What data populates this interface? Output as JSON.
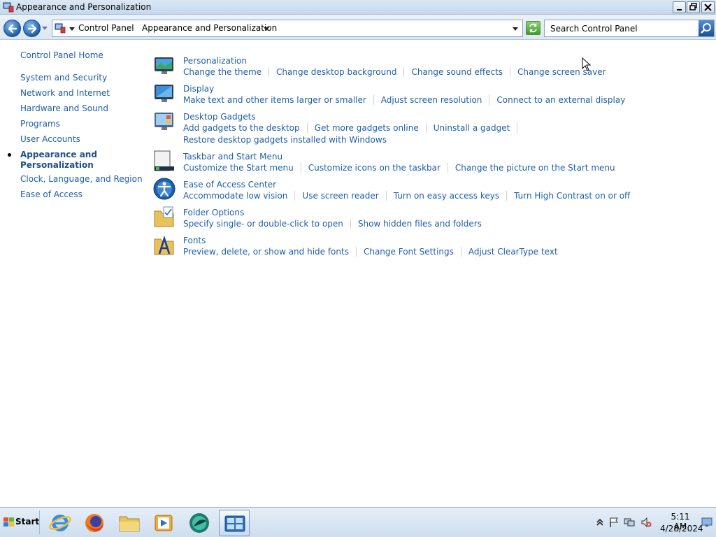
{
  "window": {
    "title": "Appearance and Personalization"
  },
  "address": {
    "crumbs": [
      "Control Panel",
      "Appearance and Personalization"
    ]
  },
  "search": {
    "placeholder": "Search Control Panel"
  },
  "leftnav": {
    "home": "Control Panel Home",
    "items": [
      "System and Security",
      "Network and Internet",
      "Hardware and Sound",
      "Programs",
      "User Accounts",
      "Appearance and Personalization",
      "Clock, Language, and Region",
      "Ease of Access"
    ],
    "current_lines": [
      "Appearance and",
      "Personalization"
    ]
  },
  "sections": [
    {
      "title": "Personalization",
      "icon": "personalization-icon",
      "links": [
        "Change the theme",
        "Change desktop background",
        "Change sound effects",
        "Change screen saver"
      ]
    },
    {
      "title": "Display",
      "icon": "display-icon",
      "links": [
        "Make text and other items larger or smaller",
        "Adjust screen resolution",
        "Connect to an external display"
      ]
    },
    {
      "title": "Desktop Gadgets",
      "icon": "gadgets-icon",
      "links": [
        "Add gadgets to the desktop",
        "Get more gadgets online",
        "Uninstall a gadget"
      ],
      "links_row2": [
        "Restore desktop gadgets installed with Windows"
      ]
    },
    {
      "title": "Taskbar and Start Menu",
      "icon": "taskbar-icon",
      "links": [
        "Customize the Start menu",
        "Customize icons on the taskbar",
        "Change the picture on the Start menu"
      ]
    },
    {
      "title": "Ease of Access Center",
      "icon": "ease-of-access-icon",
      "links": [
        "Accommodate low vision",
        "Use screen reader",
        "Turn on easy access keys",
        "Turn High Contrast on or off"
      ]
    },
    {
      "title": "Folder Options",
      "icon": "folder-options-icon",
      "links": [
        "Specify single- or double-click to open",
        "Show hidden files and folders"
      ]
    },
    {
      "title": "Fonts",
      "icon": "fonts-icon",
      "links": [
        "Preview, delete, or show and hide fonts",
        "Change Font Settings",
        "Adjust ClearType text"
      ]
    }
  ],
  "taskbar": {
    "start_label": "Start",
    "apps": [
      "internet-explorer-icon",
      "firefox-icon",
      "file-explorer-icon",
      "media-player-icon",
      "app-icon",
      "control-panel-icon"
    ],
    "time": "5:11 AM",
    "date": "4/28/2024"
  }
}
